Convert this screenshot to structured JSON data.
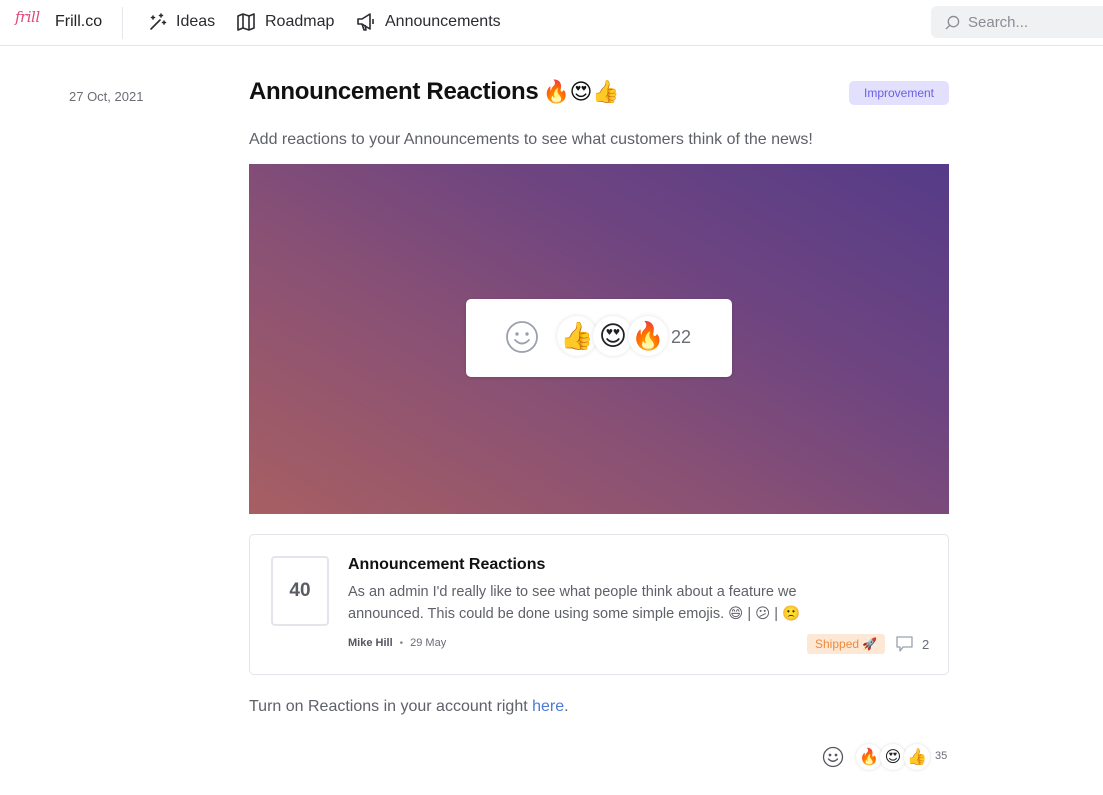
{
  "header": {
    "logo_text": "frill",
    "brand": "Frill.co",
    "nav": [
      {
        "label": "Ideas",
        "icon": "sparkles-icon"
      },
      {
        "label": "Roadmap",
        "icon": "map-icon"
      },
      {
        "label": "Announcements",
        "icon": "megaphone-icon"
      }
    ],
    "search_placeholder": "Search..."
  },
  "announcement": {
    "date": "27 Oct, 2021",
    "title": "Announcement Reactions",
    "title_emojis": "🔥😍👍",
    "badge": "Improvement",
    "subtitle": "Add reactions to your Announcements to see what customers think of the news!",
    "hero": {
      "emojis": [
        "👍",
        "😍",
        "🔥"
      ],
      "count": "22"
    },
    "idea": {
      "votes": "40",
      "title": "Announcement Reactions",
      "description": "As an admin I'd really like to see what people think about a feature we announced. This could be done using some simple emojis. 😄 | 😕 | 🙁",
      "author": "Mike Hill",
      "date": "29 May",
      "status": "Shipped 🚀",
      "comment_count": "2"
    },
    "footer_text": "Turn on Reactions in your account right ",
    "footer_link": "here",
    "footer_end": ".",
    "reactions": {
      "emojis": [
        "🔥",
        "😍",
        "👍"
      ],
      "count": "35"
    }
  },
  "colors": {
    "brand_pink": "#e0477d",
    "badge_bg": "#e3e0fd",
    "badge_text": "#6b5ee0",
    "shipped_bg": "#fde8d6",
    "shipped_text": "#f08a3a",
    "link": "#4b7bd8",
    "hero_gradient_start": "#a75f62",
    "hero_gradient_end": "#553b88"
  }
}
